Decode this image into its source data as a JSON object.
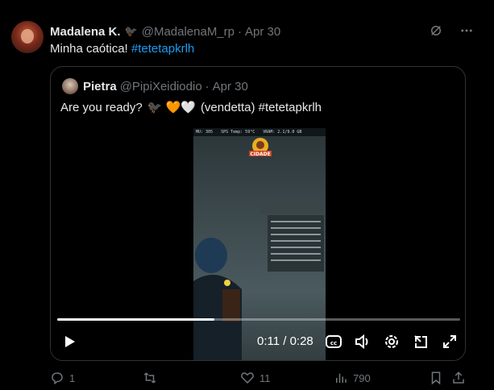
{
  "tweet": {
    "author_name": "Madalena K.",
    "author_emoji": "🐦‍⬛",
    "handle": "@MadalenaM_rp",
    "separator": "·",
    "date": "Apr 30",
    "text": "Minha caótica!",
    "hashtag": "#tetetapkrlh"
  },
  "quote": {
    "author_name": "Pietra",
    "handle": "@PipiXeidiodio",
    "separator": "·",
    "date": "Apr 30",
    "text_start": "Are you ready?",
    "emojis": "🐦‍⬛ 🧡🤍",
    "text_end": "(vendetta) #tetetapkrlh"
  },
  "video": {
    "hud_items": [
      "MU: 305",
      "SPS Temp: 59°C",
      "VRAM: 2.1/9.0 GB"
    ],
    "logo_text": "CIDADE",
    "time_display": "0:11 / 0:28",
    "progress": 0.39
  },
  "actions": {
    "replies": "1",
    "reposts": "",
    "likes": "11",
    "views": "790"
  }
}
